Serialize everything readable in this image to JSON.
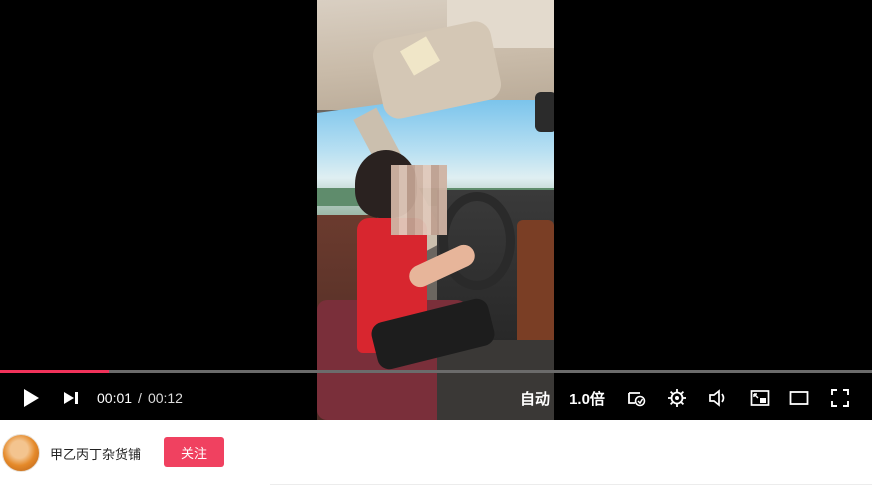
{
  "player": {
    "current_time": "00:01",
    "separator": "/",
    "duration": "00:12",
    "progress_fraction": 0.125,
    "quality_label": "自动",
    "speed_label": "1.0倍",
    "progress_color": "#f0325a"
  },
  "controls": {
    "icons": [
      "play-icon",
      "next-icon",
      "loop-icon",
      "settings-gear-icon",
      "volume-icon",
      "picture-in-picture-icon",
      "theater-mode-icon",
      "fullscreen-icon"
    ]
  },
  "author": {
    "name": "甲乙丙丁杂货铺",
    "follow_label": "关注",
    "follow_color": "#f04160"
  }
}
